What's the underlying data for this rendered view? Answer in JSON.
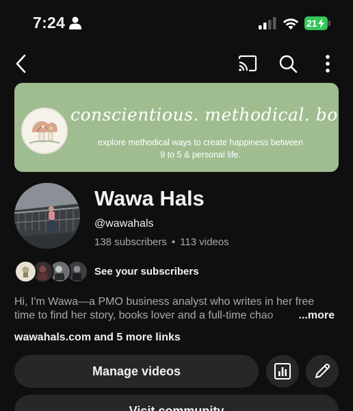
{
  "status_bar": {
    "time": "7:24",
    "battery": "21"
  },
  "nav": {
    "icons": [
      "back-icon",
      "cast-icon",
      "search-icon",
      "more-vertical-icon"
    ]
  },
  "banner": {
    "headline": "conscientious. methodical. bookish.",
    "subtitle_line1": "explore methodical ways to create happiness between",
    "subtitle_line2": "9 to 5 & personal life.",
    "background_color": "#9fbd90"
  },
  "channel": {
    "name": "Wawa Hals",
    "handle": "@wawahals",
    "subscribers": "138 subscribers",
    "separator": "•",
    "videos": "113 videos"
  },
  "subscribers_row": {
    "label": "See your subscribers"
  },
  "description": {
    "line1": "Hi, I'm Wawa—a PMO business analyst who writes in her free",
    "line2": "time to find her story, books lover and a full-time chao",
    "more_label": "...more"
  },
  "links": {
    "text": "wawahals.com and 5 more links"
  },
  "actions": {
    "manage_videos": "Manage videos",
    "visit_community": "Visit community"
  },
  "colors": {
    "background": "#0f0f0f",
    "button": "#272727",
    "secondary_text": "#aaaaaa",
    "battery": "#34c759"
  }
}
